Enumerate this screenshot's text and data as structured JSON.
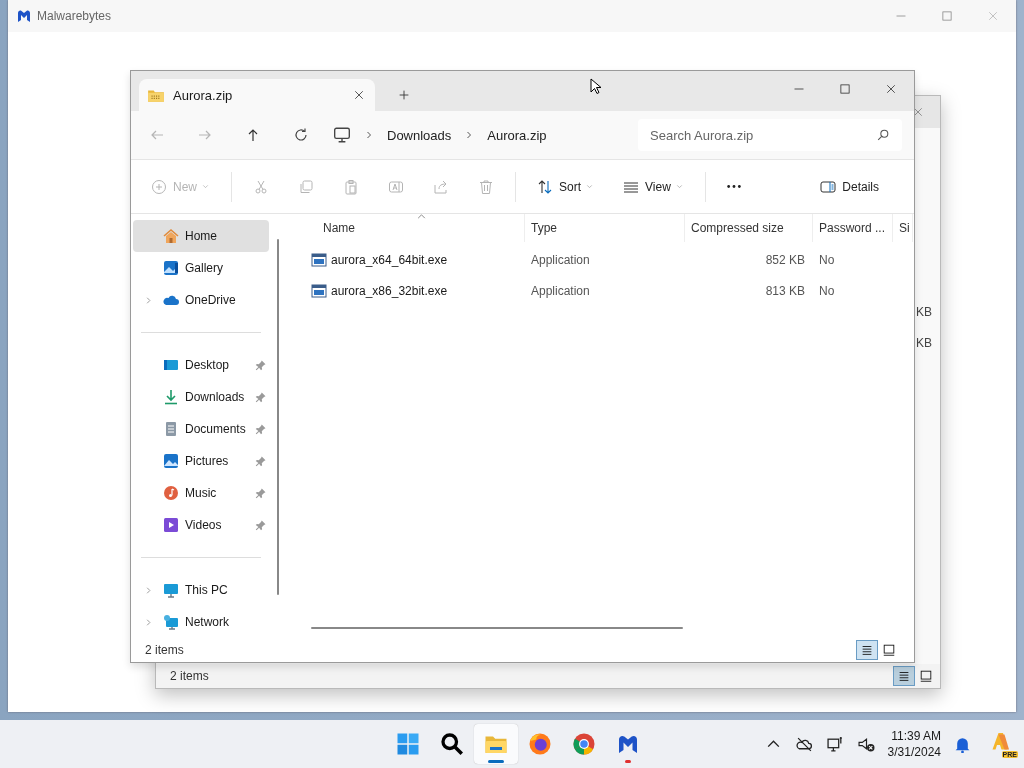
{
  "background_window": {
    "title": "Malwarebytes"
  },
  "behind_window": {
    "rows": [
      {
        "size": "KB"
      },
      {
        "size": "KB"
      }
    ],
    "status_bar": {
      "text": "2 items",
      "view_buttons": [
        {
          "kind": "details",
          "selected": true
        },
        {
          "kind": "tiles",
          "selected": false
        }
      ]
    }
  },
  "explorer": {
    "tabs": [
      {
        "title": "Aurora.zip",
        "selected": true
      }
    ],
    "address": {
      "breadcrumbs": [
        "Downloads",
        "Aurora.zip"
      ],
      "search": {
        "placeholder": "Search Aurora.zip"
      }
    },
    "command_bar": [
      {
        "kind": "new",
        "label": "New",
        "disabled": true
      },
      {
        "kind": "cut",
        "disabled": true
      },
      {
        "kind": "copy",
        "disabled": true
      },
      {
        "kind": "paste",
        "disabled": true
      },
      {
        "kind": "rename",
        "disabled": true
      },
      {
        "kind": "share",
        "disabled": true
      },
      {
        "kind": "delete",
        "disabled": true
      },
      {
        "kind": "sort",
        "label": "Sort",
        "disabled": false
      },
      {
        "kind": "view",
        "label": "View",
        "disabled": false
      },
      {
        "kind": "more",
        "disabled": false
      },
      {
        "kind": "details",
        "label": "Details",
        "disabled": false
      }
    ],
    "sidebar": {
      "groups": [
        [
          {
            "kind": "home",
            "label": "Home",
            "selected": true,
            "expandable": false,
            "pinned": false
          },
          {
            "kind": "gallery",
            "label": "Gallery",
            "selected": false,
            "expandable": false,
            "pinned": false
          },
          {
            "kind": "onedrive",
            "label": "OneDrive",
            "selected": false,
            "expandable": true,
            "pinned": false
          }
        ],
        [
          {
            "kind": "desktop",
            "label": "Desktop",
            "selected": false,
            "expandable": false,
            "pinned": true
          },
          {
            "kind": "downloads",
            "label": "Downloads",
            "selected": false,
            "expandable": false,
            "pinned": true
          },
          {
            "kind": "documents",
            "label": "Documents",
            "selected": false,
            "expandable": false,
            "pinned": true
          },
          {
            "kind": "pictures",
            "label": "Pictures",
            "selected": false,
            "expandable": false,
            "pinned": true
          },
          {
            "kind": "music",
            "label": "Music",
            "selected": false,
            "expandable": false,
            "pinned": true
          },
          {
            "kind": "videos",
            "label": "Videos",
            "selected": false,
            "expandable": false,
            "pinned": true
          }
        ],
        [
          {
            "kind": "thispc",
            "label": "This PC",
            "selected": false,
            "expandable": true,
            "pinned": false
          },
          {
            "kind": "network",
            "label": "Network",
            "selected": false,
            "expandable": true,
            "pinned": false
          }
        ]
      ]
    },
    "table": {
      "columns": [
        {
          "label": "Name",
          "sorted": true
        },
        {
          "label": "Type",
          "sorted": false
        },
        {
          "label": "Compressed size",
          "sorted": false
        },
        {
          "label": "Password ...",
          "sorted": false
        },
        {
          "label": "Si",
          "sorted": false
        }
      ],
      "rows": [
        {
          "name": "aurora_x64_64bit.exe",
          "type": "Application",
          "compressed_size": "852 KB",
          "password": "No"
        },
        {
          "name": "aurora_x86_32bit.exe",
          "type": "Application",
          "compressed_size": "813 KB",
          "password": "No"
        }
      ]
    },
    "status_bar": {
      "text": "2 items",
      "view_buttons": [
        {
          "kind": "details",
          "selected": true
        },
        {
          "kind": "tiles",
          "selected": false
        }
      ]
    }
  },
  "taskbar": {
    "apps": [
      {
        "kind": "start",
        "selected": false,
        "running": false
      },
      {
        "kind": "search",
        "selected": false,
        "running": false
      },
      {
        "kind": "explorer",
        "selected": true,
        "running": true
      },
      {
        "kind": "firefox",
        "selected": false,
        "running": false
      },
      {
        "kind": "chrome",
        "selected": false,
        "running": false
      },
      {
        "kind": "malwarebytes",
        "selected": false,
        "running": true
      }
    ],
    "tray": [
      {
        "kind": "chevron"
      },
      {
        "kind": "cloud-off"
      },
      {
        "kind": "network"
      },
      {
        "kind": "muted"
      }
    ],
    "clock": {
      "time": "11:39 AM",
      "date": "3/31/2024"
    },
    "extras": [
      {
        "kind": "bell"
      },
      {
        "kind": "copilot",
        "badge": "PRE"
      }
    ]
  }
}
